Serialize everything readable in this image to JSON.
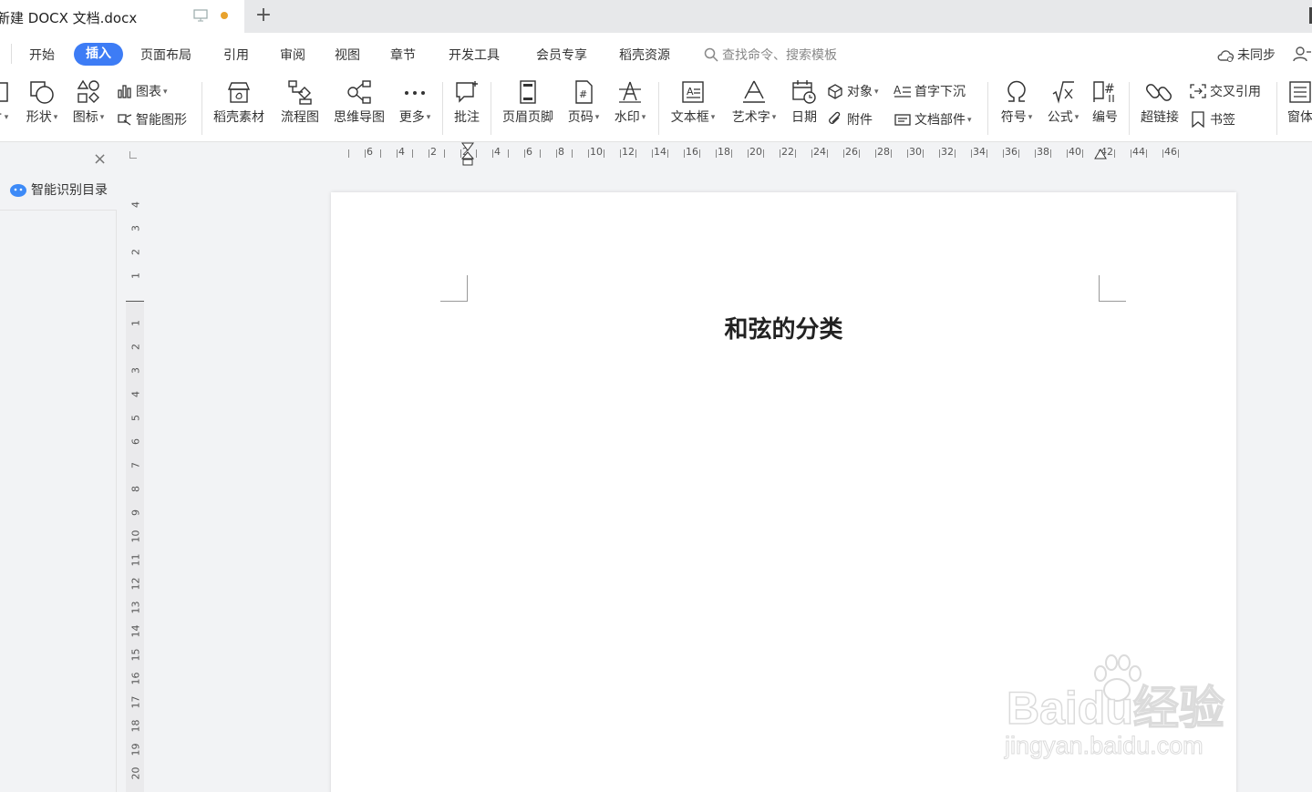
{
  "tab": {
    "title": "新建 DOCX 文档.docx",
    "new_tab_symbol": "+",
    "unsaved_dot_color": "#e8a22d"
  },
  "menu": {
    "items": [
      "开始",
      "插入",
      "页面布局",
      "引用",
      "审阅",
      "视图",
      "章节",
      "开发工具",
      "会员专享",
      "稻壳资源"
    ],
    "active": "插入",
    "active_color": "#3d7cf5",
    "search_placeholder": "查找命令、搜索模板",
    "sync_label": "未同步"
  },
  "ribbon": {
    "partial_left_label": "片",
    "shape": "形状",
    "icon_lib": "图标",
    "chart": "图表",
    "smart_graphic": "智能图形",
    "daoke_material": "稻壳素材",
    "flowchart": "流程图",
    "mindmap": "思维导图",
    "more": "更多",
    "comment": "批注",
    "header_footer": "页眉页脚",
    "page_number": "页码",
    "watermark": "水印",
    "textbox": "文本框",
    "wordart": "艺术字",
    "date": "日期",
    "object": "对象",
    "attachment": "附件",
    "drop_cap": "首字下沉",
    "doc_parts": "文档部件",
    "symbol": "符号",
    "formula": "公式",
    "numbering": "编号",
    "hyperlink": "超链接",
    "cross_ref": "交叉引用",
    "bookmark": "书签",
    "window": "窗体"
  },
  "left_panel": {
    "title": "智能识别目录",
    "close_symbol": "×"
  },
  "hruler": {
    "labels": [
      "6",
      "4",
      "2",
      "2",
      "4",
      "6",
      "8",
      "10",
      "12",
      "14",
      "16",
      "18",
      "20",
      "22",
      "24",
      "26",
      "28",
      "30",
      "32",
      "34",
      "36",
      "38",
      "40",
      "42",
      "44",
      "46"
    ]
  },
  "vruler": {
    "top_labels": [
      "4",
      "3",
      "2",
      "1"
    ],
    "bottom_labels": [
      "1",
      "2",
      "3",
      "4",
      "5",
      "6",
      "7",
      "8",
      "9",
      "10",
      "11",
      "12",
      "13",
      "14",
      "15",
      "16",
      "17",
      "18",
      "19",
      "20"
    ]
  },
  "document": {
    "title": "和弦的分类"
  },
  "watermark": {
    "text": "Baidu经验",
    "sub": "jingyan.baidu.com"
  }
}
